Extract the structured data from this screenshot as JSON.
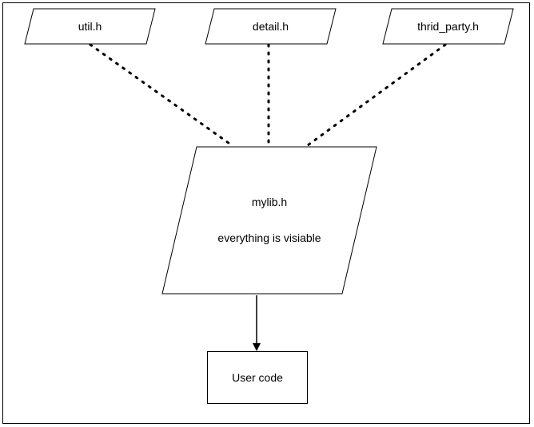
{
  "nodes": {
    "util": {
      "label": "util.h"
    },
    "detail": {
      "label": "detail.h"
    },
    "third_party": {
      "label": "thrid_party.h"
    },
    "mylib": {
      "label": "mylib.h",
      "subtitle": "everything is visiable"
    },
    "user_code": {
      "label": "User code"
    }
  },
  "edges": [
    {
      "from": "util",
      "to": "mylib",
      "style": "dotted"
    },
    {
      "from": "detail",
      "to": "mylib",
      "style": "dotted"
    },
    {
      "from": "third_party",
      "to": "mylib",
      "style": "dotted"
    },
    {
      "from": "mylib",
      "to": "user_code",
      "style": "solid-arrow"
    }
  ]
}
